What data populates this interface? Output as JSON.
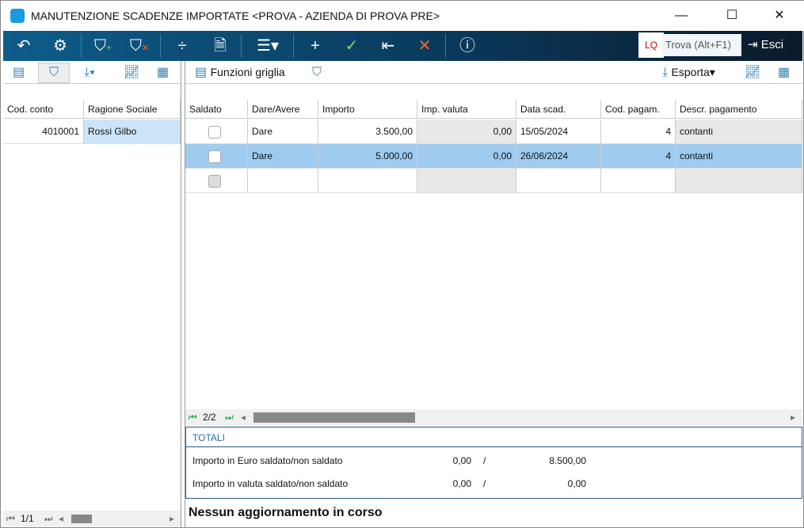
{
  "window": {
    "title": "MANUTENZIONE SCADENZE IMPORTATE <PROVA - AZIENDA DI PROVA PRE>"
  },
  "toolbar": {
    "lq": "LQ",
    "find_placeholder": "Trova (Alt+F1)",
    "exit_label": "Esci"
  },
  "right_toolbar": {
    "grid_functions": "Funzioni griglia",
    "export": "Esporta"
  },
  "left_grid": {
    "headers": [
      "Cod. conto",
      "Ragione Sociale"
    ],
    "rows": [
      [
        "4010001",
        "Rossi Gilbo"
      ]
    ],
    "pager": "1/1"
  },
  "grid": {
    "headers": [
      "Saldato",
      "Dare/Avere",
      "Importo",
      "Imp. valuta",
      "Data scad.",
      "Cod. pagam.",
      "Descr. pagamento"
    ],
    "rows": [
      {
        "saldato": false,
        "dare_avere": "Dare",
        "importo": "3.500,00",
        "imp_valuta": "0,00",
        "data_scad": "15/05/2024",
        "cod_pagam": "4",
        "descr": "contanti"
      },
      {
        "saldato": false,
        "dare_avere": "Dare",
        "importo": "5.000,00",
        "imp_valuta": "0,00",
        "data_scad": "26/06/2024",
        "cod_pagam": "4",
        "descr": "contanti"
      },
      {
        "saldato": false,
        "dare_avere": "",
        "importo": "",
        "imp_valuta": "",
        "data_scad": "",
        "cod_pagam": "",
        "descr": ""
      }
    ],
    "pager": "2/2"
  },
  "totals": {
    "title": "TOTALI",
    "rows": [
      {
        "label": "Importo in Euro saldato/non saldato",
        "saldato": "0,00",
        "sep": "/",
        "non_saldato": "8.500,00"
      },
      {
        "label": "Importo in valuta saldato/non saldato",
        "saldato": "0,00",
        "sep": "/",
        "non_saldato": "0,00"
      }
    ]
  },
  "status": "Nessun aggiornamento in corso"
}
